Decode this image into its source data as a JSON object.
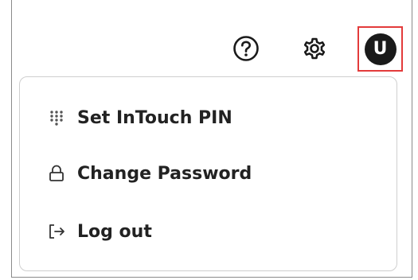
{
  "header": {
    "help_icon": "help-circle-icon",
    "settings_icon": "gear-icon",
    "avatar_initial": "U",
    "avatar_highlight_color": "#e33b3b"
  },
  "menu": {
    "items": [
      {
        "label": "Set InTouch PIN",
        "icon": "keypad-icon"
      },
      {
        "label": "Change Password",
        "icon": "lock-icon"
      },
      {
        "label": "Log out",
        "icon": "logout-icon"
      }
    ]
  }
}
